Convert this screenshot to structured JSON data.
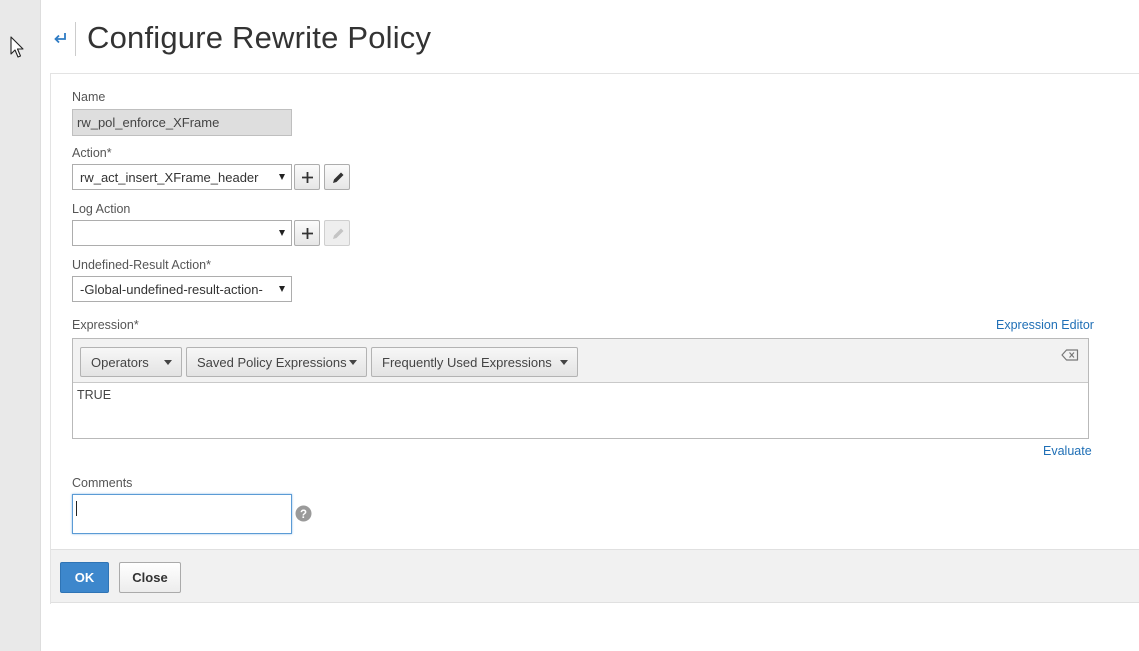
{
  "header": {
    "title": "Configure Rewrite Policy"
  },
  "form": {
    "name": {
      "label": "Name",
      "value": "rw_pol_enforce_XFrame"
    },
    "action": {
      "label": "Action*",
      "value": "rw_act_insert_XFrame_header"
    },
    "log_action": {
      "label": "Log Action",
      "value": ""
    },
    "undefined_result_action": {
      "label": "Undefined-Result Action*",
      "value": "-Global-undefined-result-action-"
    },
    "expression": {
      "label": "Expression*",
      "editor_link": "Expression Editor",
      "toolbar": [
        "Operators",
        "Saved Policy Expressions",
        "Frequently Used Expressions"
      ],
      "value": "TRUE",
      "evaluate_link": "Evaluate"
    },
    "comments": {
      "label": "Comments",
      "value": ""
    }
  },
  "footer": {
    "ok_label": "OK",
    "close_label": "Close"
  },
  "icons": {
    "back": "back-arrow-icon",
    "add": "plus-icon",
    "edit": "pencil-icon",
    "clear": "backspace-icon",
    "help": "question-mark-icon",
    "cursor": "mouse-pointer-icon"
  },
  "colors": {
    "primary": "#3d87cc",
    "link": "#1f6fb6",
    "readonly_field": "#dedede"
  }
}
